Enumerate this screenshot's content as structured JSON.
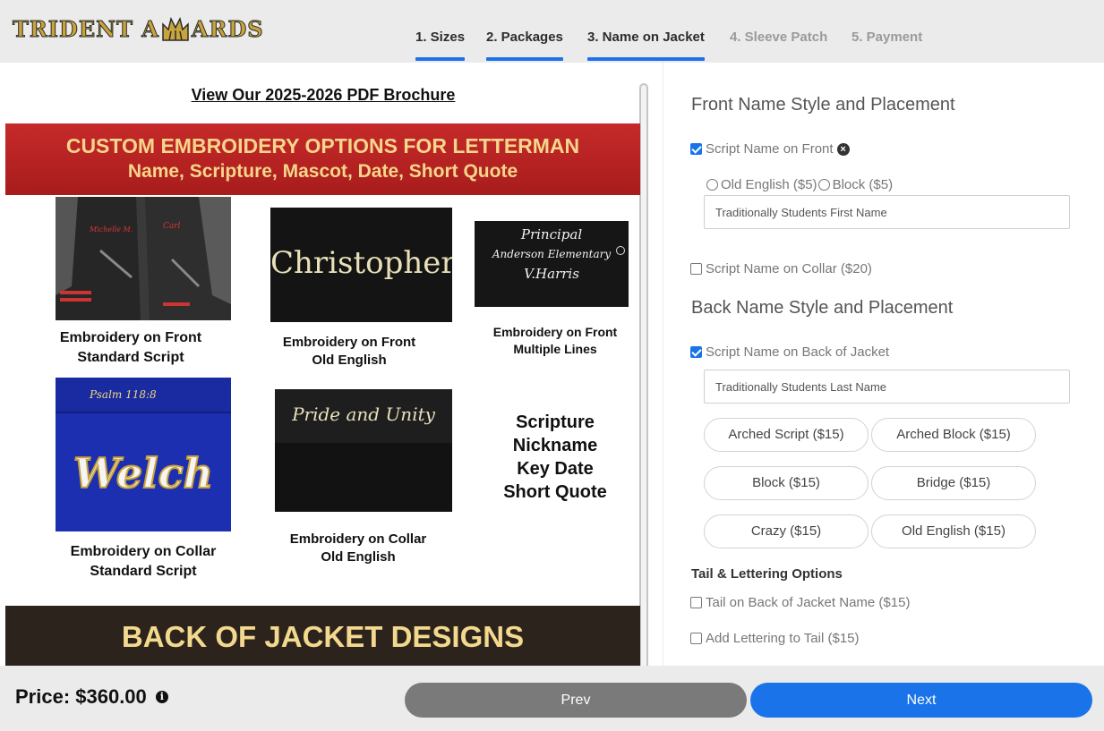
{
  "header": {
    "logo_text_left": "TRIDENT A",
    "logo_text_right": "ARDS",
    "steps": [
      {
        "label": "1. Sizes",
        "state": "done"
      },
      {
        "label": "2. Packages",
        "state": "done"
      },
      {
        "label": "3. Name on Jacket",
        "state": "current"
      },
      {
        "label": "4. Sleeve Patch",
        "state": "todo"
      },
      {
        "label": "5. Payment",
        "state": "todo"
      }
    ]
  },
  "left": {
    "brochure_link": "View Our 2025-2026 PDF Brochure",
    "banner_top": {
      "line1": "CUSTOM EMBROIDERY OPTIONS FOR LETTERMAN",
      "line2": "Name, Scripture, Mascot, Date, Short Quote"
    },
    "examples": [
      {
        "image_text": [
          "Michelle M.",
          "Carl"
        ],
        "caption": [
          "Embroidery on Front",
          "Standard Script"
        ]
      },
      {
        "image_text": [
          "Christopher"
        ],
        "caption": [
          "Embroidery on Front",
          "Old English"
        ]
      },
      {
        "image_text": [
          "Principal",
          "Anderson Elementary",
          "V.Harris"
        ],
        "caption": [
          "Embroidery on Front",
          "Multiple Lines"
        ]
      },
      {
        "image_text": [
          "Psalm 118:8",
          "Welch"
        ],
        "caption": [
          "Embroidery on Collar",
          "Standard Script"
        ]
      },
      {
        "image_text": [
          "Pride and Unity"
        ],
        "caption": [
          "Embroidery on Collar",
          "Old English"
        ]
      }
    ],
    "scripture_list": [
      "Scripture",
      "Nickname",
      "Key Date",
      "Short Quote"
    ],
    "banner_bottom": "BACK OF JACKET DESIGNS"
  },
  "right": {
    "front_title": "Front Name Style and Placement",
    "script_front": {
      "label": "Script Name on Front",
      "checked": true
    },
    "front_styles": [
      {
        "label": "Old English ($5)",
        "selected": false
      },
      {
        "label": "Block ($5)",
        "selected": false
      }
    ],
    "front_placeholder": "Traditionally Students First Name",
    "script_collar": {
      "label": "Script Name on Collar ($20)",
      "checked": false
    },
    "back_title": "Back Name Style and Placement",
    "script_back": {
      "label": "Script Name on Back of Jacket",
      "checked": true
    },
    "back_placeholder": "Traditionally Students Last Name",
    "back_styles": [
      "Arched Script ($15)",
      "Arched Block ($15)",
      "Block ($15)",
      "Bridge ($15)",
      "Crazy ($15)",
      "Old English ($15)"
    ],
    "tail_title": "Tail & Lettering Options",
    "tail_back": {
      "label": "Tail on Back of Jacket Name ($15)",
      "checked": false
    },
    "tail_lettering": {
      "label": "Add Lettering to Tail ($15)",
      "checked": false
    }
  },
  "footer": {
    "price": "Price: $360.00",
    "prev_label": "Prev",
    "next_label": "Next"
  },
  "colors": {
    "accent": "#1a73e8",
    "banner_red": "#b22222",
    "banner_gold": "#f5d68a",
    "prev_button": "#7a7a7a"
  }
}
